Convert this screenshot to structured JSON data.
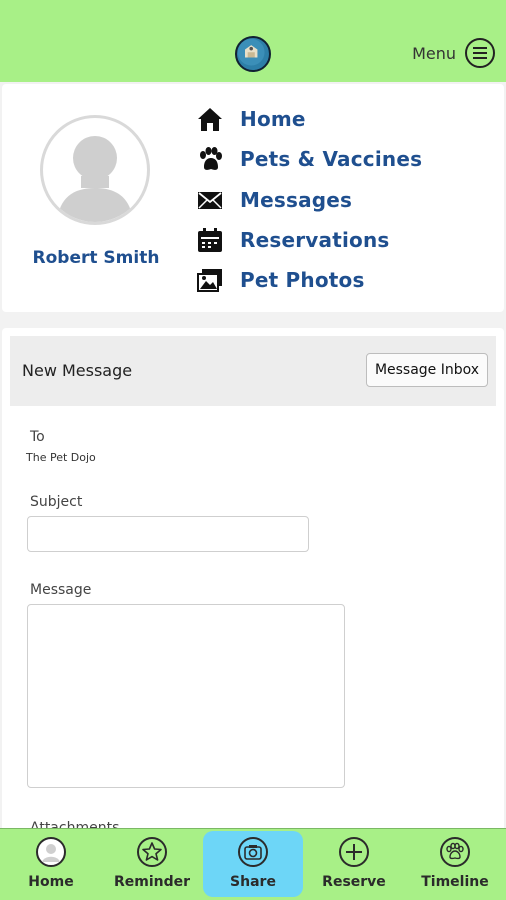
{
  "header": {
    "menu_label": "Menu"
  },
  "profile": {
    "name": "Robert Smith"
  },
  "nav": [
    {
      "label": "Home",
      "icon": "home-icon"
    },
    {
      "label": "Pets & Vaccines",
      "icon": "paw-icon"
    },
    {
      "label": "Messages",
      "icon": "envelope-icon"
    },
    {
      "label": "Reservations",
      "icon": "calendar-icon"
    },
    {
      "label": "Pet Photos",
      "icon": "photos-icon"
    }
  ],
  "form": {
    "title": "New Message",
    "inbox_button": "Message Inbox",
    "to_label": "To",
    "to_value": "The Pet Dojo",
    "subject_label": "Subject",
    "subject_value": "",
    "message_label": "Message",
    "message_value": "",
    "attachments_label": "Attachments"
  },
  "tabs": [
    {
      "label": "Home",
      "icon": "avatar-icon",
      "active": false
    },
    {
      "label": "Reminder",
      "icon": "star-icon",
      "active": false
    },
    {
      "label": "Share",
      "icon": "camera-icon",
      "active": true
    },
    {
      "label": "Reserve",
      "icon": "plus-icon",
      "active": false
    },
    {
      "label": "Timeline",
      "icon": "paw-icon",
      "active": false
    }
  ],
  "colors": {
    "header": "#a8f087",
    "accent": "#1f4f8f",
    "active_tab": "#6dd6f7"
  }
}
